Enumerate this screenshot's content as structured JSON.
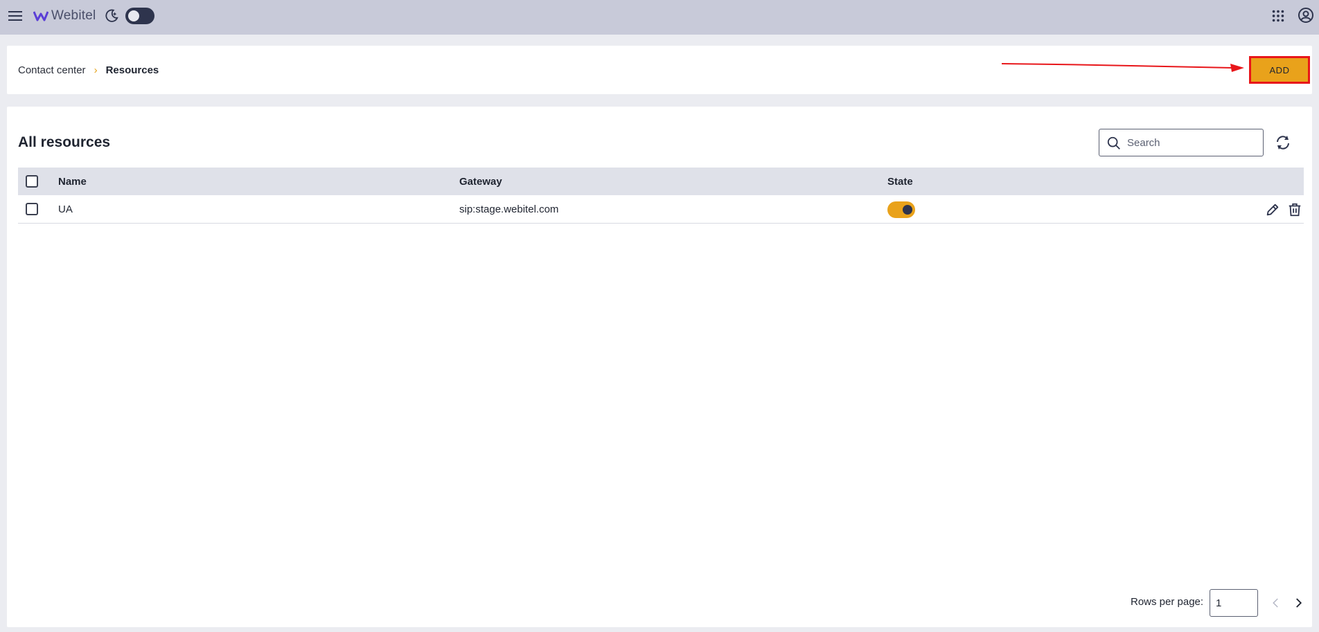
{
  "topbar": {
    "logo_text": "Webitel",
    "icons": [
      "menu-icon",
      "webitel-logo-icon",
      "moon-icon",
      "apps-grid-icon",
      "account-icon"
    ],
    "theme_toggle_on": false
  },
  "header": {
    "breadcrumb": [
      {
        "label": "Contact center"
      },
      {
        "label": "Resources"
      }
    ],
    "breadcrumb_separator": "›",
    "add_label": "ADD"
  },
  "main": {
    "title": "All resources",
    "search": {
      "placeholder": "Search",
      "value": ""
    },
    "table": {
      "columns": [
        "Name",
        "Gateway",
        "State"
      ],
      "rows": [
        {
          "name": "UA",
          "gateway": "sip:stage.webitel.com",
          "state": true
        }
      ]
    },
    "pagination": {
      "rows_per_page_label": "Rows per page:",
      "rows_per_page_value": "1"
    }
  },
  "colors": {
    "accent": "#e9a21b",
    "topbar": "#c8cad9",
    "annotation_red": "#e8161a",
    "dark": "#2e344d"
  }
}
